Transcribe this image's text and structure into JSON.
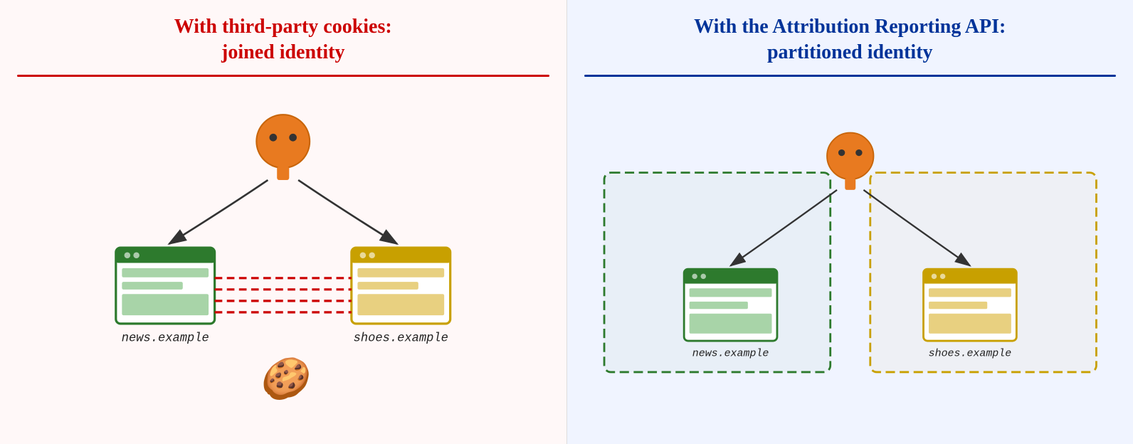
{
  "left_panel": {
    "title_line1": "With third-party cookies:",
    "title_line2": "joined identity",
    "color": "#cc0000",
    "bg": "#fff8f8",
    "browser1_label": "news.example",
    "browser2_label": "shoes.example"
  },
  "right_panel": {
    "title_line1": "With the Attribution Reporting API:",
    "title_line2": "partitioned identity",
    "color": "#003399",
    "bg": "#f0f4ff",
    "browser1_label": "news.example",
    "browser2_label": "shoes.example"
  }
}
